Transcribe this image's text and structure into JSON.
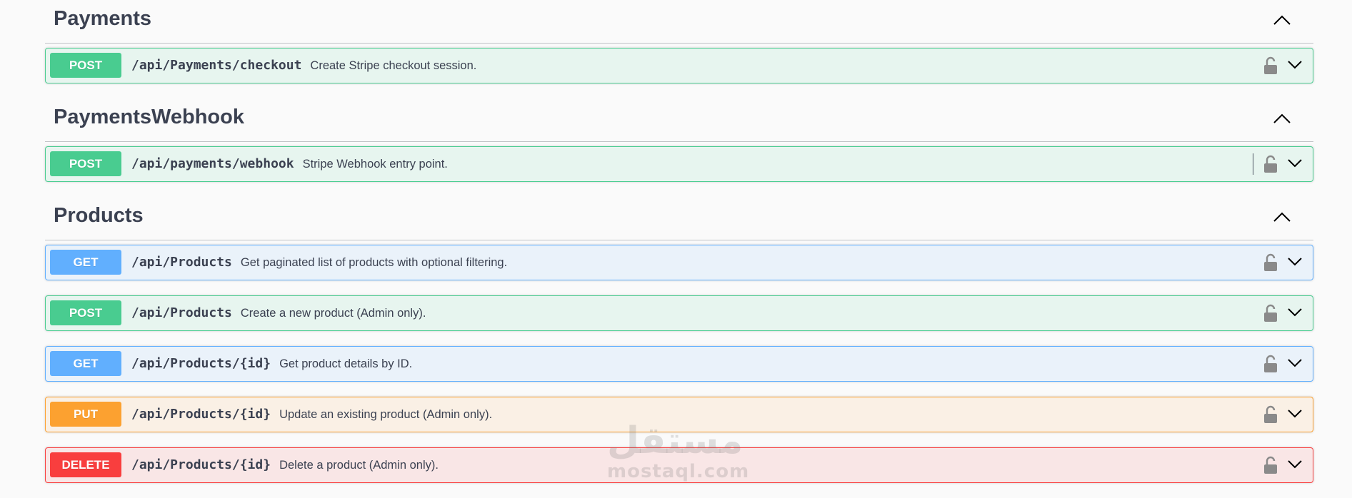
{
  "sections": [
    {
      "title": "Payments",
      "operations": [
        {
          "method": "POST",
          "path": "/api/Payments/checkout",
          "summary": "Create Stripe checkout session."
        }
      ]
    },
    {
      "title": "PaymentsWebhook",
      "operations": [
        {
          "method": "POST",
          "path": "/api/payments/webhook",
          "summary": "Stripe Webhook entry point."
        }
      ]
    },
    {
      "title": "Products",
      "operations": [
        {
          "method": "GET",
          "path": "/api/Products",
          "summary": "Get paginated list of products with optional filtering."
        },
        {
          "method": "POST",
          "path": "/api/Products",
          "summary": "Create a new product (Admin only)."
        },
        {
          "method": "GET",
          "path": "/api/Products/{id}",
          "summary": "Get product details by ID."
        },
        {
          "method": "PUT",
          "path": "/api/Products/{id}",
          "summary": "Update an existing product (Admin only)."
        },
        {
          "method": "DELETE",
          "path": "/api/Products/{id}",
          "summary": "Delete a product (Admin only)."
        }
      ]
    }
  ],
  "icons": {
    "section_toggle": "chevron-up-icon",
    "operation_toggle": "chevron-down-icon",
    "auth": "unlocked-padlock-icon"
  },
  "colors": {
    "post": "#49cc90",
    "get": "#61affe",
    "put": "#fca130",
    "delete": "#f93e3e",
    "text": "#3b4151"
  },
  "watermark": {
    "arabic": "مستقل",
    "latin": "mostaql.com"
  }
}
